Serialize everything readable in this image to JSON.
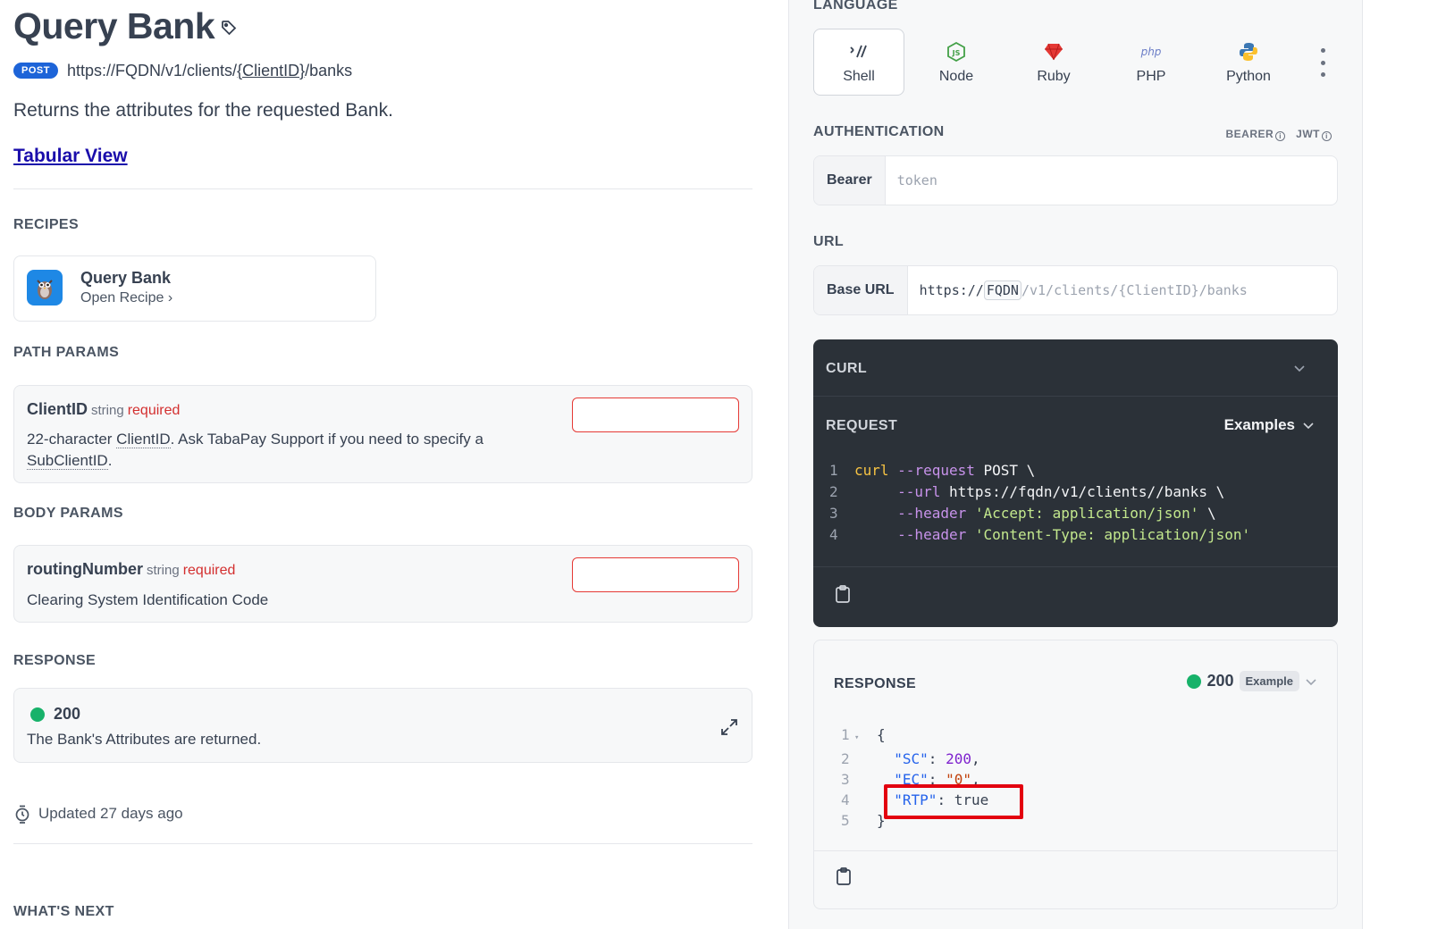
{
  "page": {
    "title": "Query Bank",
    "method": "POST",
    "url_prefix": "https://FQDN/v1/clients/",
    "url_param": "{ClientID}",
    "url_suffix": "/banks",
    "description": "Returns the attributes for the requested Bank.",
    "tabular_link": "Tabular View"
  },
  "recipes": {
    "label": "RECIPES",
    "card_title": "Query Bank",
    "card_link": "Open Recipe ›"
  },
  "path_params": {
    "label": "PATH PARAMS",
    "name": "ClientID",
    "type": "string",
    "required": "required",
    "desc_line1_pre": "22-character ",
    "desc_term1": "ClientID",
    "desc_line1_post": ". Ask TabaPay Support if you need to specify a",
    "desc_term2": "SubClientID",
    "desc_line2_post": "."
  },
  "body_params": {
    "label": "BODY PARAMS",
    "name": "routingNumber",
    "type": "string",
    "required": "required",
    "desc": "Clearing System Identification Code"
  },
  "response": {
    "label": "RESPONSE",
    "code": "200",
    "desc": "The Bank's Attributes are returned.",
    "status_color": "#17b26a"
  },
  "updated": "Updated 27 days ago",
  "whats_next": "WHAT'S NEXT",
  "language": {
    "label": "LANGUAGE",
    "items": [
      "Shell",
      "Node",
      "Ruby",
      "PHP",
      "Python"
    ],
    "active": "Shell"
  },
  "auth": {
    "label": "AUTHENTICATION",
    "types": [
      "BEARER",
      "JWT"
    ],
    "field_label": "Bearer",
    "placeholder": "token"
  },
  "url_section": {
    "label": "URL",
    "field_label": "Base URL",
    "scheme": "https://",
    "host": "FQDN",
    "path": "/v1/clients/{ClientID}/banks"
  },
  "curl": {
    "title": "CURL",
    "request_label": "REQUEST",
    "examples_label": "Examples",
    "lines": [
      {
        "n": "1",
        "cmd": "curl",
        "flag": " --request",
        "rest": " POST \\",
        "str": ""
      },
      {
        "n": "2",
        "cmd": "",
        "flag": "     --url",
        "rest": " https://fqdn/v1/clients//banks \\",
        "str": ""
      },
      {
        "n": "3",
        "cmd": "",
        "flag": "     --header",
        "rest": " ",
        "str": "'Accept: application/json'",
        "tail": " \\"
      },
      {
        "n": "4",
        "cmd": "",
        "flag": "     --header",
        "rest": " ",
        "str": "'Content-Type: application/json'",
        "tail": ""
      }
    ]
  },
  "response_panel": {
    "title": "RESPONSE",
    "code": "200",
    "badge": "Example",
    "json": {
      "l1": "{",
      "sc_key": "\"SC\"",
      "sc_val": "200",
      "ec_key": "\"EC\"",
      "ec_val": "\"0\"",
      "rtp_key": "\"RTP\"",
      "rtp_val": "true",
      "l5": "}"
    },
    "line_numbers": [
      "1",
      "2",
      "3",
      "4",
      "5"
    ]
  },
  "colors": {
    "accent": "#1d64d8",
    "required": "#d32f2f",
    "highlight": "#e3000f",
    "code_bg": "#2b3138"
  }
}
